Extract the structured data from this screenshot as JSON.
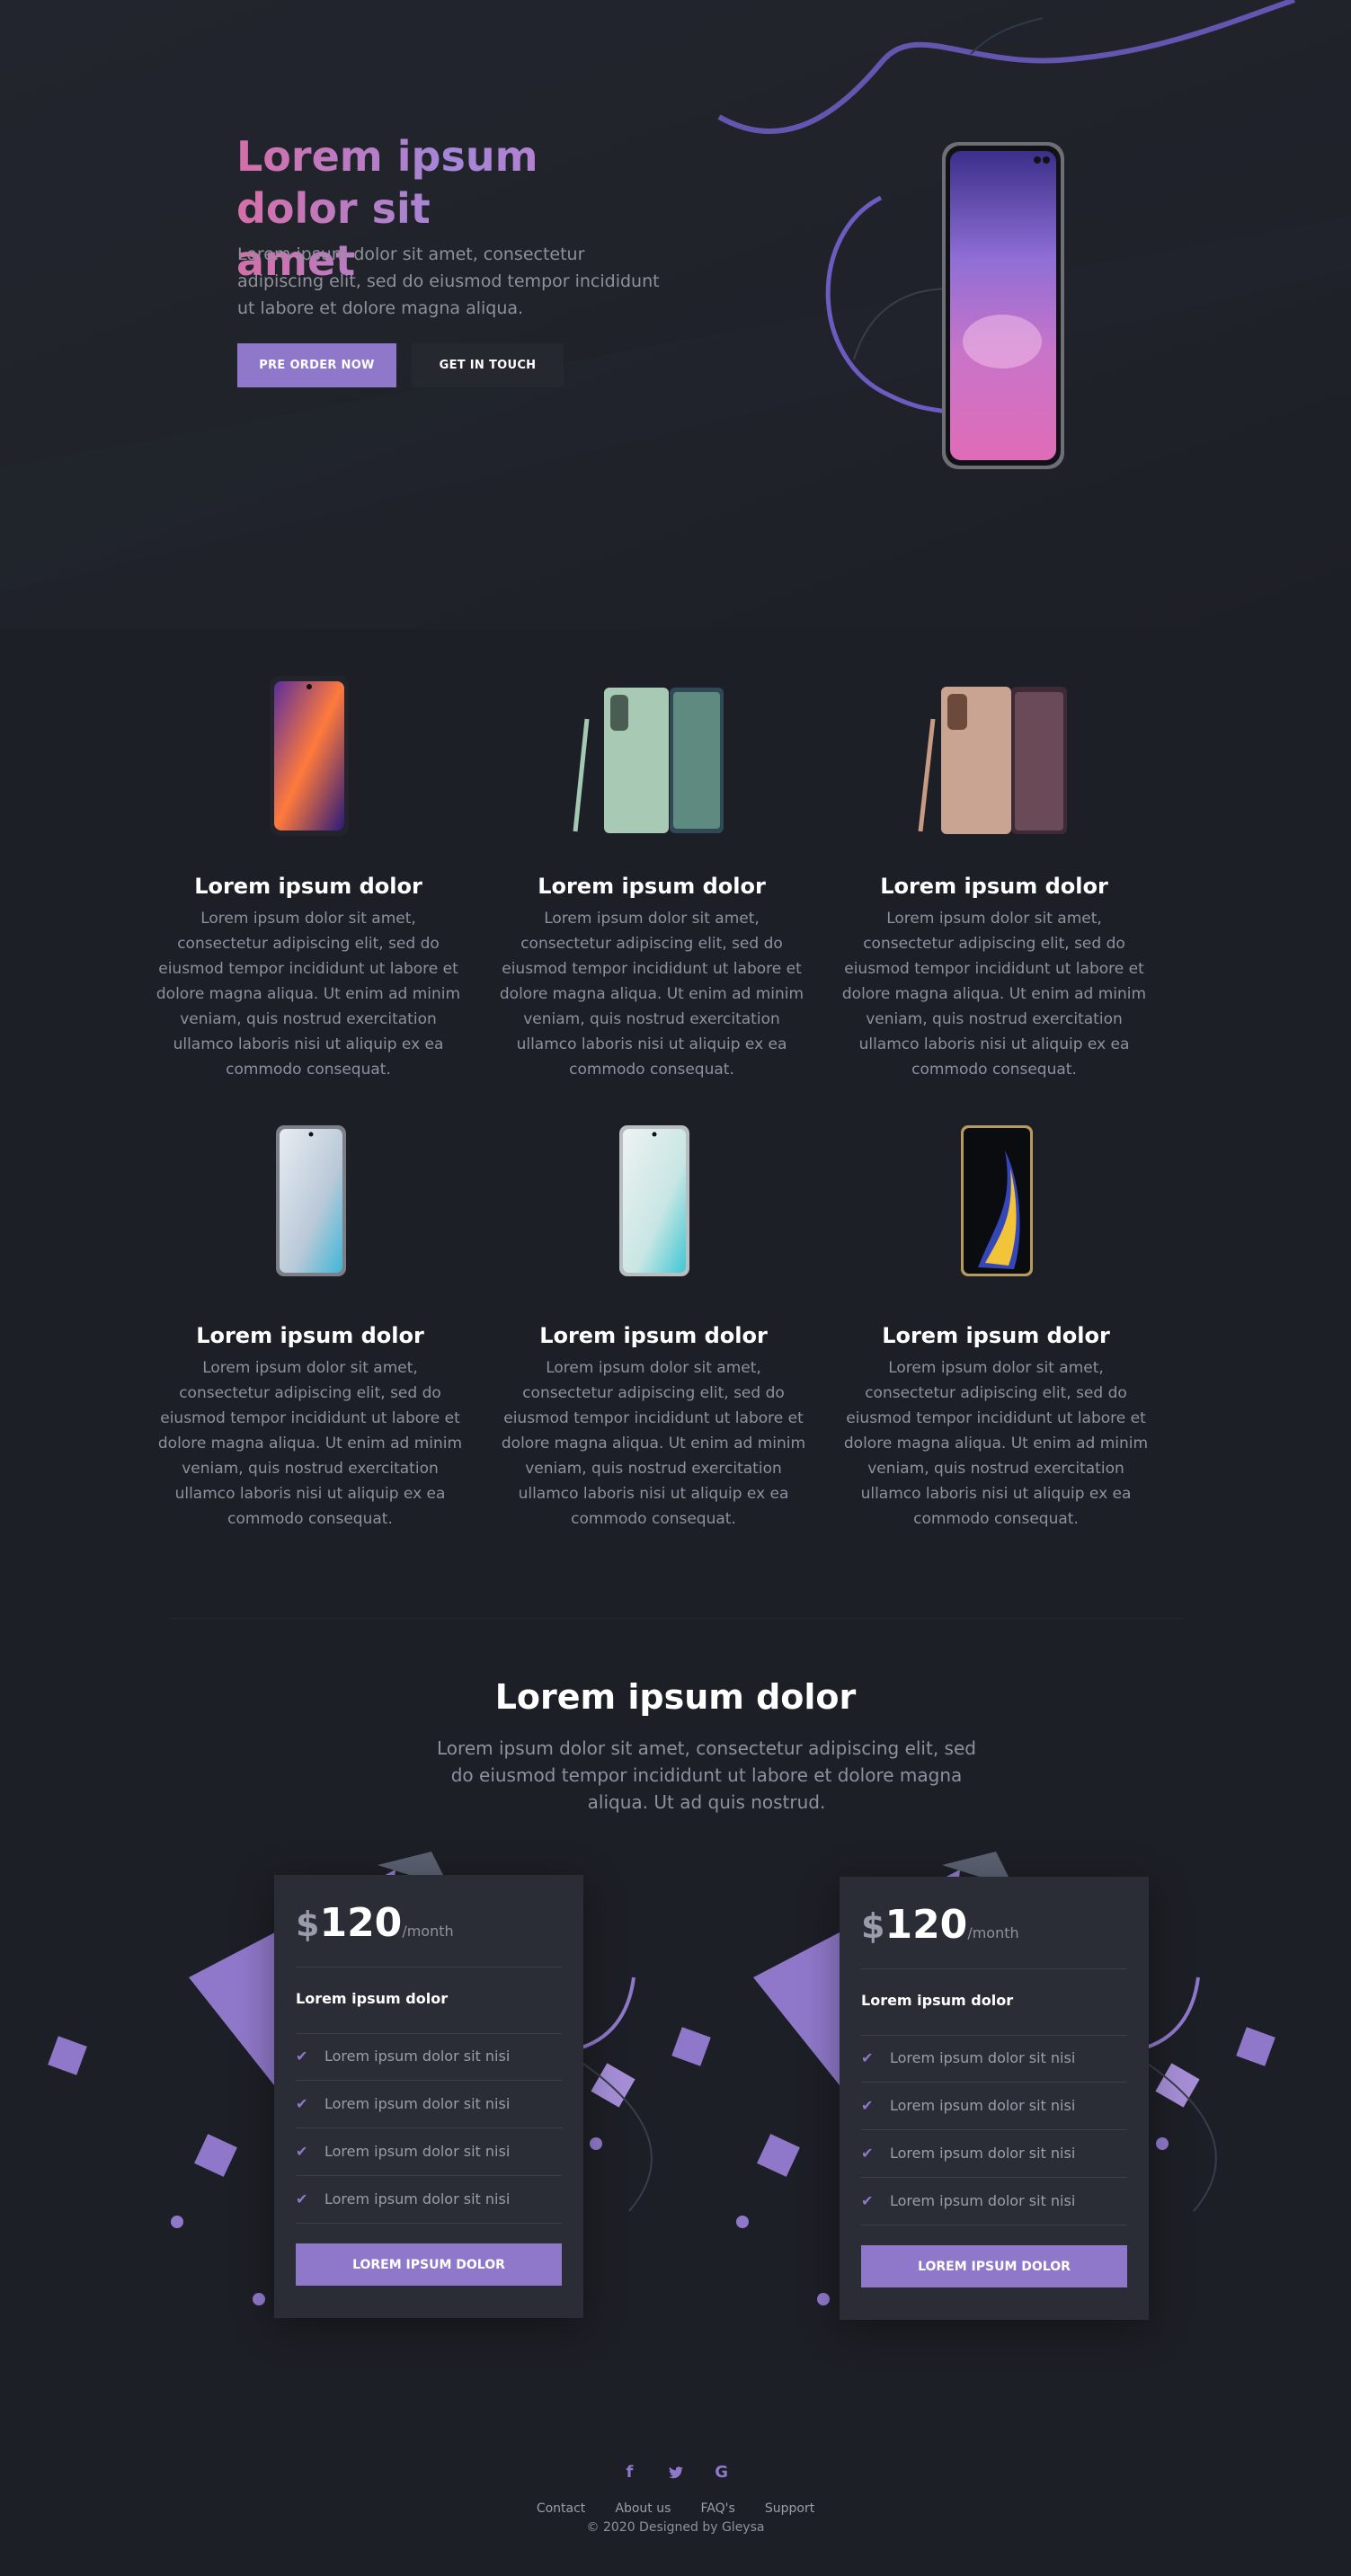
{
  "colors": {
    "accent": "#8f78c9",
    "background": "#1d1f26",
    "card": "#2b2d36",
    "muted_text": "#8e919c"
  },
  "hero": {
    "title_line1": "Lorem ipsum dolor sit",
    "title_line2": "amet",
    "description": "Lorem ipsum dolor sit amet, consectetur adipiscing elit, sed do eiusmod tempor incididunt ut labore et dolore magna aliqua.",
    "primary_button": "PRE ORDER NOW",
    "secondary_button": "GET IN TOUCH"
  },
  "products": [
    {
      "title": "Lorem ipsum dolor",
      "description": "Lorem ipsum dolor sit amet, consectetur adipiscing elit, sed do eiusmod tempor incididunt ut labore et dolore magna aliqua. Ut enim ad minim veniam, quis nostrud exercitation ullamco laboris nisi ut aliquip ex ea commodo consequat.",
      "image": "phone-colorful"
    },
    {
      "title": "Lorem ipsum dolor",
      "description": "Lorem ipsum dolor sit amet, consectetur adipiscing elit, sed do eiusmod tempor incididunt ut labore et dolore magna aliqua. Ut enim ad minim veniam, quis nostrud exercitation ullamco laboris nisi ut aliquip ex ea commodo consequat.",
      "image": "phone-green-with-pen"
    },
    {
      "title": "Lorem ipsum dolor",
      "description": "Lorem ipsum dolor sit amet, consectetur adipiscing elit, sed do eiusmod tempor incididunt ut labore et dolore magna aliqua. Ut enim ad minim veniam, quis nostrud exercitation ullamco laboris nisi ut aliquip ex ea commodo consequat.",
      "image": "phone-bronze-with-pen"
    },
    {
      "title": "Lorem ipsum dolor",
      "description": "Lorem ipsum dolor sit amet, consectetur adipiscing elit, sed do eiusmod tempor incididunt ut labore et dolore magna aliqua. Ut enim ad minim veniam, quis nostrud exercitation ullamco laboris nisi ut aliquip ex ea commodo consequat.",
      "image": "phone-silver"
    },
    {
      "title": "Lorem ipsum dolor",
      "description": "Lorem ipsum dolor sit amet, consectetur adipiscing elit, sed do eiusmod tempor incididunt ut labore et dolore magna aliqua. Ut enim ad minim veniam, quis nostrud exercitation ullamco laboris nisi ut aliquip ex ea commodo consequat.",
      "image": "phone-white"
    },
    {
      "title": "Lorem ipsum dolor",
      "description": "Lorem ipsum dolor sit amet, consectetur adipiscing elit, sed do eiusmod tempor incididunt ut labore et dolore magna aliqua. Ut enim ad minim veniam, quis nostrud exercitation ullamco laboris nisi ut aliquip ex ea commodo consequat.",
      "image": "phone-black-blue"
    }
  ],
  "pricing": {
    "title": "Lorem ipsum dolor",
    "description": "Lorem ipsum dolor sit amet, consectetur adipiscing elit, sed do eiusmod tempor incididunt ut labore et dolore magna aliqua. Ut ad quis nostrud.",
    "cards": [
      {
        "currency": "$",
        "amount": "120",
        "period": "/month",
        "plan_name": "Lorem ipsum dolor",
        "features": [
          "Lorem ipsum dolor sit nisi",
          "Lorem ipsum dolor sit nisi",
          "Lorem ipsum dolor sit nisi",
          "Lorem ipsum dolor sit nisi"
        ],
        "button": "LOREM IPSUM DOLOR"
      },
      {
        "currency": "$",
        "amount": "120",
        "period": "/month",
        "plan_name": "Lorem ipsum dolor",
        "features": [
          "Lorem ipsum dolor sit nisi",
          "Lorem ipsum dolor sit nisi",
          "Lorem ipsum dolor sit nisi",
          "Lorem ipsum dolor sit nisi"
        ],
        "button": "LOREM IPSUM DOLOR"
      }
    ]
  },
  "footer": {
    "social": [
      {
        "icon": "facebook-icon",
        "glyph": "f"
      },
      {
        "icon": "twitter-icon",
        "glyph": "🐦"
      },
      {
        "icon": "google-icon",
        "glyph": "G"
      }
    ],
    "links": [
      "Contact",
      "About us",
      "FAQ's",
      "Support"
    ],
    "copyright": "© 2020 Designed by Gleysa"
  }
}
